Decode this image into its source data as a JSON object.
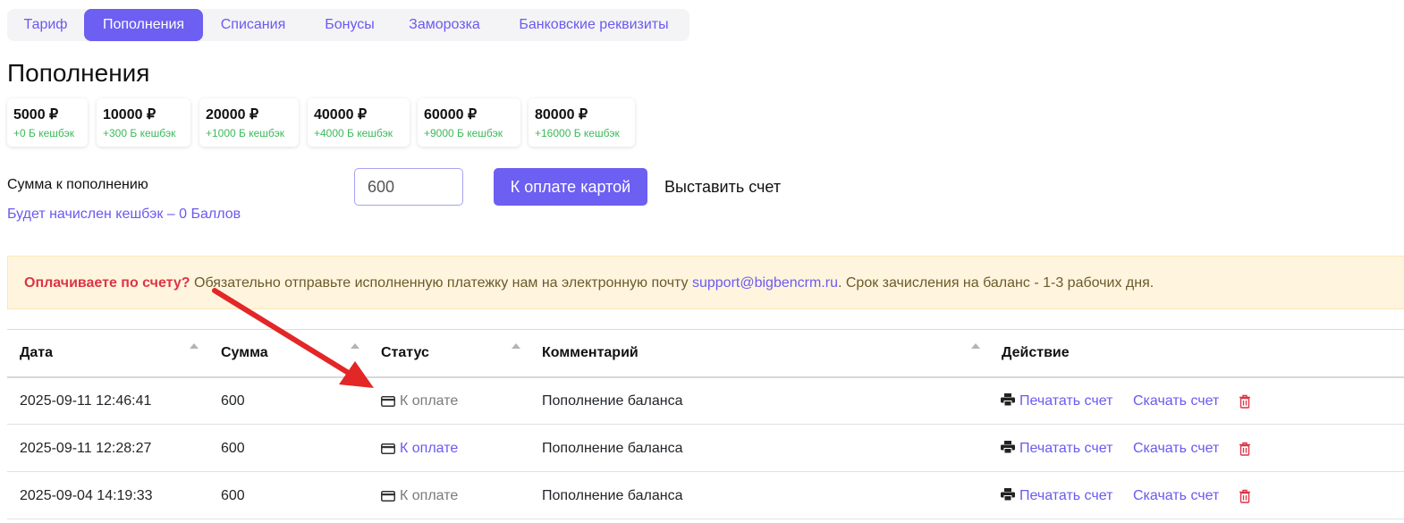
{
  "tabs": [
    {
      "label": "Тариф"
    },
    {
      "label": "Пополнения"
    },
    {
      "label": "Списания"
    },
    {
      "label": "Бонусы"
    },
    {
      "label": "Заморозка"
    },
    {
      "label": "Банковские реквизиты"
    }
  ],
  "active_tab": "Пополнения",
  "page_title": "Пополнения",
  "amounts": [
    {
      "amount": "5000 ₽",
      "cashback": "+0 Б кешбэк"
    },
    {
      "amount": "10000 ₽",
      "cashback": "+300 Б кешбэк"
    },
    {
      "amount": "20000 ₽",
      "cashback": "+1000 Б кешбэк"
    },
    {
      "amount": "40000 ₽",
      "cashback": "+4000 Б кешбэк"
    },
    {
      "amount": "60000 ₽",
      "cashback": "+9000 Б кешбэк"
    },
    {
      "amount": "80000 ₽",
      "cashback": "+16000 Б кешбэк"
    }
  ],
  "form": {
    "sum_label": "Сумма к пополнению",
    "cashback_note": "Будет начислен кешбэк – 0 Баллов",
    "amount_value": "600",
    "pay_card_label": "К оплате картой",
    "invoice_label": "Выставить счет"
  },
  "notice": {
    "bold": "Оплачиваете по счету?",
    "text_before": " Обязательно отправьте исполненную платежку нам на электронную почту ",
    "email": "support@bigbencrm.ru",
    "text_after": ". Срок зачисления на баланс - 1-3 рабочих дня."
  },
  "table": {
    "headers": {
      "date": "Дата",
      "sum": "Сумма",
      "status": "Статус",
      "comment": "Комментарий",
      "action": "Действие"
    },
    "rows": [
      {
        "date": "2025-09-11 12:46:41",
        "sum": "600",
        "status": "К оплате",
        "comment": "Пополнение баланса",
        "print": "Печатать счет",
        "download": "Скачать счет"
      },
      {
        "date": "2025-09-11 12:28:27",
        "sum": "600",
        "status": "К оплате",
        "comment": "Пополнение баланса",
        "print": "Печатать счет",
        "download": "Скачать счет"
      },
      {
        "date": "2025-09-04 14:19:33",
        "sum": "600",
        "status": "К оплате",
        "comment": "Пополнение баланса",
        "print": "Печатать счет",
        "download": "Скачать счет"
      }
    ]
  },
  "colors": {
    "accent": "#6c5ff2",
    "cashback_green": "#3cb95a",
    "danger": "#dc3545",
    "notice_bg": "#fff5de",
    "annotation_arrow": "#e32626"
  },
  "icons": {
    "status": "credit-card-icon",
    "print": "printer-icon",
    "delete": "trash-icon",
    "annotation": "red-arrow"
  }
}
